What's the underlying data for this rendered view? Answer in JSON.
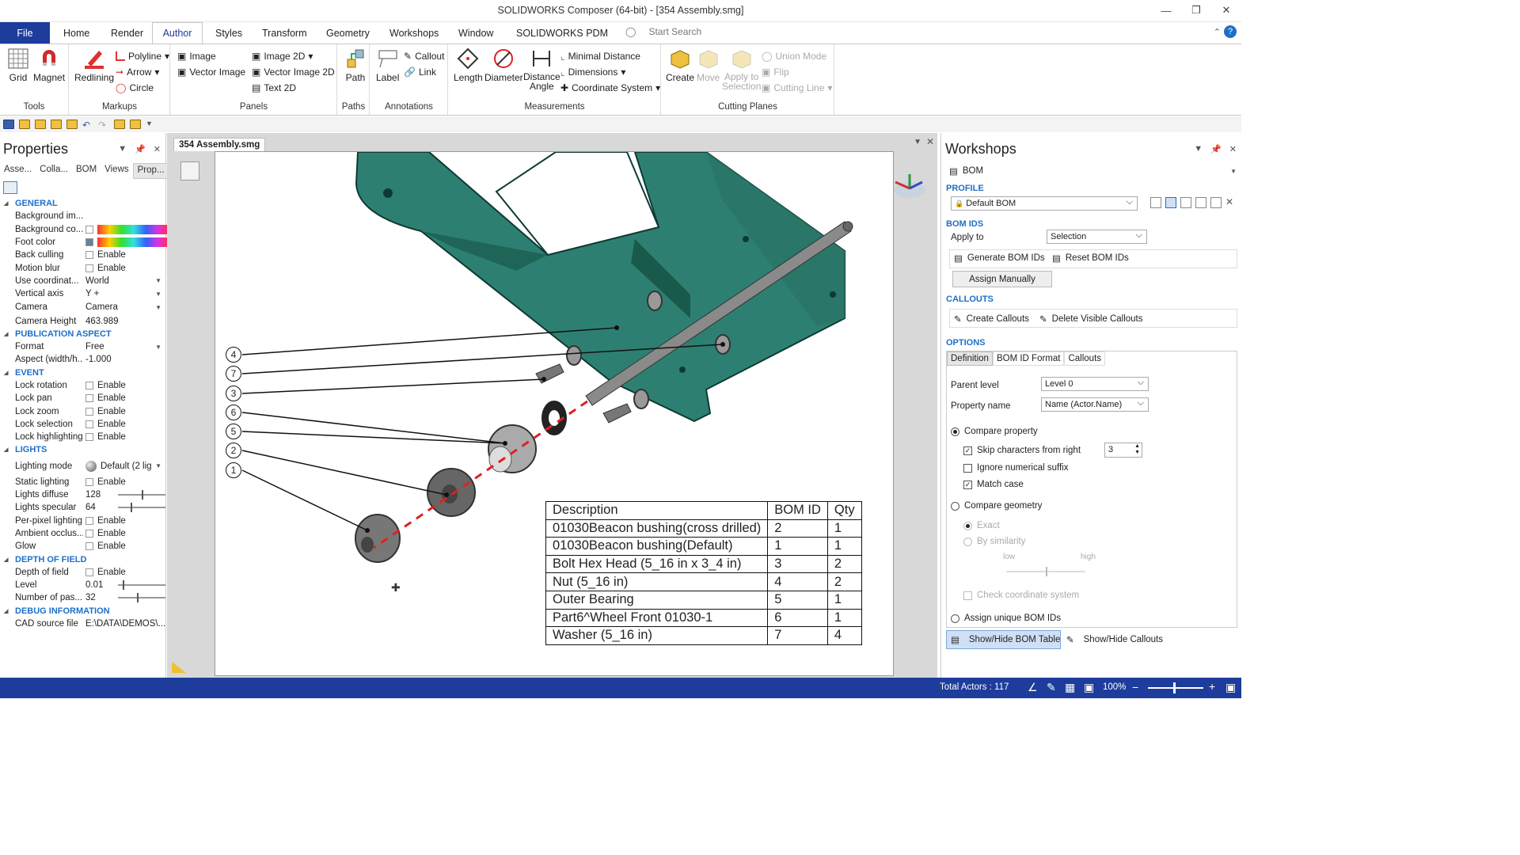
{
  "window": {
    "title": "SOLIDWORKS Composer (64-bit) - [354 Assembly.smg]"
  },
  "ribbon_tabs": [
    "File",
    "Home",
    "Render",
    "Author",
    "Styles",
    "Transform",
    "Geometry",
    "Workshops",
    "Window",
    "SOLIDWORKS PDM"
  ],
  "search": {
    "placeholder": "Start Search"
  },
  "ribbon": {
    "tools": {
      "label": "Tools",
      "grid": "Grid",
      "magnet": "Magnet"
    },
    "markups": {
      "label": "Markups",
      "redlining": "Redlining",
      "polyline": "Polyline",
      "arrow": "Arrow",
      "circle": "Circle"
    },
    "panels": {
      "label": "Panels",
      "image": "Image",
      "vector_image": "Vector Image",
      "image2d": "Image 2D",
      "vector_image2d": "Vector Image 2D",
      "text2d": "Text 2D"
    },
    "paths": {
      "label": "Paths",
      "path": "Path"
    },
    "annotations": {
      "label": "Annotations",
      "label_btn": "Label",
      "callout": "Callout",
      "link": "Link"
    },
    "measurements": {
      "label": "Measurements",
      "length": "Length",
      "diameter": "Diameter",
      "distance": "Distance",
      "angle": "Angle",
      "minimal_distance": "Minimal Distance",
      "dimensions": "Dimensions",
      "coordinate_system": "Coordinate System"
    },
    "cutting": {
      "label": "Cutting Planes",
      "create": "Create",
      "move": "Move",
      "apply1": "Apply to",
      "apply2": "Selection",
      "union": "Union Mode",
      "flip": "Flip",
      "cutting_line": "Cutting Line"
    }
  },
  "left": {
    "title": "Properties",
    "tabs": [
      "Asse...",
      "Colla...",
      "BOM",
      "Views",
      "Prop..."
    ],
    "sections": {
      "general": "GENERAL",
      "publication": "PUBLICATION ASPECT",
      "event": "EVENT",
      "lights": "LIGHTS",
      "dof": "DEPTH OF FIELD",
      "debug": "DEBUG INFORMATION"
    },
    "props": {
      "bg_image": "Background im...",
      "bg_color": "Background co...",
      "foot_color": "Foot color",
      "back_culling": "Back culling",
      "motion_blur": "Motion blur",
      "use_coord": "Use coordinat...",
      "use_coord_val": "World",
      "vertical_axis": "Vertical axis",
      "vertical_axis_val": "Y +",
      "camera": "Camera",
      "camera_val": "Camera",
      "camera_height": "Camera Height",
      "camera_height_val": "463.989",
      "format": "Format",
      "format_val": "Free",
      "aspect": "Aspect (width/h...",
      "aspect_val": "-1.000",
      "lock_rotation": "Lock rotation",
      "lock_pan": "Lock pan",
      "lock_zoom": "Lock zoom",
      "lock_selection": "Lock selection",
      "lock_highlighting": "Lock highlighting",
      "lighting_mode": "Lighting mode",
      "lighting_mode_val": "Default (2 lig",
      "static_lighting": "Static lighting",
      "lights_diffuse": "Lights diffuse",
      "lights_diffuse_val": "128",
      "lights_specular": "Lights specular",
      "lights_specular_val": "64",
      "per_pixel": "Per-pixel lighting",
      "ambient": "Ambient occlus...",
      "glow": "Glow",
      "depth_of_field": "Depth of field",
      "level": "Level",
      "level_val": "0.01",
      "num_passes": "Number of pas...",
      "num_passes_val": "32",
      "cad_source": "CAD source file",
      "cad_source_val": "E:\\DATA\\DEMOS\\..."
    },
    "enable": "Enable"
  },
  "document": {
    "tab": "354 Assembly.smg"
  },
  "callouts": [
    "4",
    "7",
    "3",
    "6",
    "5",
    "2",
    "1"
  ],
  "bom_table": {
    "headers": [
      "Description",
      "BOM ID",
      "Qty"
    ],
    "rows": [
      [
        "01030Beacon bushing(cross drilled)",
        "2",
        "1"
      ],
      [
        "01030Beacon bushing(Default)",
        "1",
        "1"
      ],
      [
        "Bolt Hex Head (5_16 in x 3_4 in)",
        "3",
        "2"
      ],
      [
        "Nut (5_16 in)",
        "4",
        "2"
      ],
      [
        "Outer Bearing",
        "5",
        "1"
      ],
      [
        "Part6^Wheel Front 01030-1",
        "6",
        "1"
      ],
      [
        "Washer (5_16 in)",
        "7",
        "4"
      ]
    ]
  },
  "right": {
    "title": "Workshops",
    "workshop": "BOM",
    "profile": "PROFILE",
    "profile_val": "Default BOM",
    "bom_ids": "BOM IDS",
    "apply_to": "Apply to",
    "apply_to_val": "Selection",
    "generate": "Generate BOM IDs",
    "reset": "Reset BOM IDs",
    "assign": "Assign Manually",
    "callouts": "CALLOUTS",
    "create_callouts": "Create Callouts",
    "delete_callouts": "Delete Visible Callouts",
    "options": "OPTIONS",
    "opt_tabs": [
      "Definition",
      "BOM ID Format",
      "Callouts"
    ],
    "parent_level": "Parent level",
    "parent_level_val": "Level 0",
    "property_name": "Property name",
    "property_name_val": "Name (Actor.Name)",
    "compare_property": "Compare property",
    "skip_chars": "Skip characters from right",
    "skip_val": "3",
    "ignore_suffix": "Ignore numerical suffix",
    "match_case": "Match case",
    "compare_geometry": "Compare geometry",
    "exact": "Exact",
    "by_similarity": "By similarity",
    "low": "low",
    "high": "high",
    "check_coord": "Check coordinate system",
    "assign_unique": "Assign unique BOM IDs",
    "show_hide_table": "Show/Hide BOM Table",
    "show_hide_callouts": "Show/Hide Callouts"
  },
  "status": {
    "total_actors": "Total Actors : 117",
    "zoom": "100%"
  }
}
